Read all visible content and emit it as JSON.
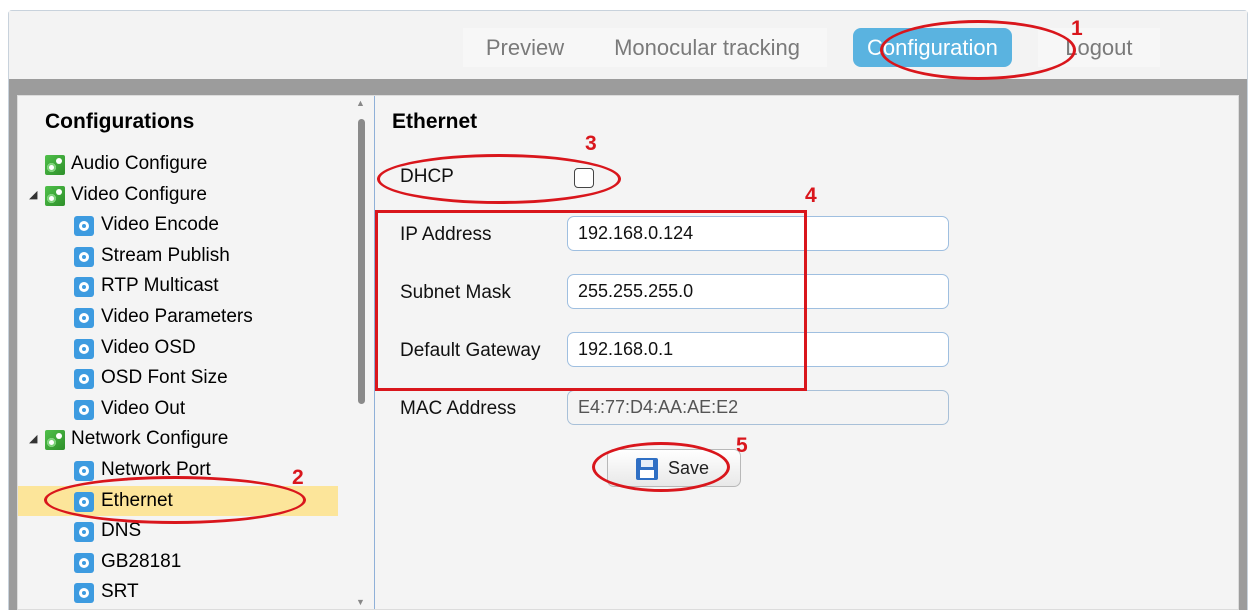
{
  "nav": {
    "items": [
      {
        "label": "Preview"
      },
      {
        "label": "Monocular tracking"
      },
      {
        "label": "Configuration",
        "active": true
      },
      {
        "label": "Logout"
      }
    ]
  },
  "sidebar": {
    "title": "Configurations",
    "tree": [
      {
        "label": "Audio Configure",
        "type": "group",
        "expanded": false
      },
      {
        "label": "Video Configure",
        "type": "group",
        "expanded": true
      },
      {
        "label": "Video Encode",
        "type": "item"
      },
      {
        "label": "Stream Publish",
        "type": "item"
      },
      {
        "label": "RTP Multicast",
        "type": "item"
      },
      {
        "label": "Video Parameters",
        "type": "item"
      },
      {
        "label": "Video OSD",
        "type": "item"
      },
      {
        "label": "OSD Font Size",
        "type": "item"
      },
      {
        "label": "Video Out",
        "type": "item"
      },
      {
        "label": "Network Configure",
        "type": "group",
        "expanded": true
      },
      {
        "label": "Network Port",
        "type": "item"
      },
      {
        "label": "Ethernet",
        "type": "item",
        "selected": true
      },
      {
        "label": "DNS",
        "type": "item"
      },
      {
        "label": "GB28181",
        "type": "item"
      },
      {
        "label": "SRT",
        "type": "item"
      }
    ]
  },
  "main": {
    "title": "Ethernet",
    "dhcp": {
      "label": "DHCP",
      "checked": false
    },
    "ip_address": {
      "label": "IP Address",
      "value": "192.168.0.124"
    },
    "subnet_mask": {
      "label": "Subnet Mask",
      "value": "255.255.255.0"
    },
    "default_gateway": {
      "label": "Default Gateway",
      "value": "192.168.0.1"
    },
    "mac_address": {
      "label": "MAC Address",
      "value": "E4:77:D4:AA:AE:E2"
    },
    "save_label": "Save"
  },
  "annotations": {
    "numbers": [
      "1",
      "2",
      "3",
      "4",
      "5"
    ],
    "color": "#d9161c"
  },
  "colors": {
    "accent": "#5ab3e0",
    "selected_row": "#fce59a",
    "frame": "#9c9c9c"
  }
}
